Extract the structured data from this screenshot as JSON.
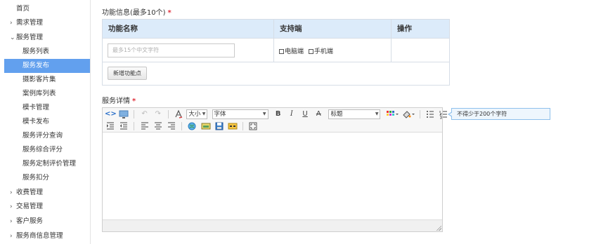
{
  "sidebar": {
    "items": [
      {
        "label": "首页",
        "type": "top",
        "arrow": ""
      },
      {
        "label": "需求管理",
        "type": "top",
        "arrow": "›"
      },
      {
        "label": "服务管理",
        "type": "top",
        "arrow": "⌄"
      },
      {
        "label": "服务列表",
        "type": "child"
      },
      {
        "label": "服务发布",
        "type": "child",
        "active": true
      },
      {
        "label": "摄影客片集",
        "type": "child"
      },
      {
        "label": "案例库列表",
        "type": "child"
      },
      {
        "label": "模卡管理",
        "type": "child"
      },
      {
        "label": "模卡发布",
        "type": "child"
      },
      {
        "label": "服务评分查询",
        "type": "child"
      },
      {
        "label": "服务综合评分",
        "type": "child"
      },
      {
        "label": "服务定制评价管理",
        "type": "child"
      },
      {
        "label": "服务扣分",
        "type": "child"
      },
      {
        "label": "收费管理",
        "type": "top",
        "arrow": "›"
      },
      {
        "label": "交易管理",
        "type": "top",
        "arrow": "›"
      },
      {
        "label": "客户服务",
        "type": "top",
        "arrow": "›"
      },
      {
        "label": "服务商信息管理",
        "type": "top",
        "arrow": "›"
      }
    ]
  },
  "function_section": {
    "title": "功能信息(最多10个)",
    "required_mark": "*",
    "headers": {
      "name": "功能名称",
      "support": "支持端",
      "action": "操作"
    },
    "name_input_placeholder": "最多15个中文字符",
    "checkboxes": {
      "pc": "电脑端",
      "mobile": "手机端"
    },
    "add_button": "新增功能点"
  },
  "detail_section": {
    "title": "服务详情",
    "required_mark": "*",
    "hint": "不得少于200个字符"
  },
  "toolbar": {
    "size_select": "大小",
    "font_select": "字体",
    "heading_select": "标题",
    "bold": "B",
    "italic": "I",
    "underline": "U",
    "strike": "A"
  },
  "colors": {
    "accent": "#62a0ee",
    "table_header_bg": "#dcebfa",
    "required": "#e0303b",
    "hint_border": "#8ec0ec"
  }
}
